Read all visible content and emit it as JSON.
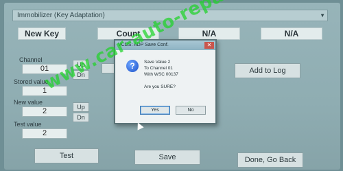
{
  "module_select": {
    "value": "Immobilizer (Key Adaptation)"
  },
  "headers": {
    "new_key": "New Key",
    "count": "Count",
    "na1": "N/A",
    "na2": "N/A"
  },
  "channel": {
    "label": "Channel",
    "value": "01",
    "up": "Up",
    "dn": "Dn"
  },
  "stored": {
    "label": "Stored value",
    "value": "1"
  },
  "new_value": {
    "label": "New value",
    "value": "2",
    "up": "Up",
    "dn": "Dn"
  },
  "test_value": {
    "label": "Test value",
    "value": "2"
  },
  "buttons": {
    "add_to_log": "Add to Log",
    "test": "Test",
    "save": "Save",
    "done": "Done, Go Back"
  },
  "dialog": {
    "title": "VCDS: ADP Save Conf.",
    "line1": "Save Value 2",
    "line2": "To Channel 01",
    "line3": "With WSC 00137",
    "question": "Are you SURE?",
    "yes": "Yes",
    "no": "No"
  },
  "watermark": "www.car-auto-repair.com"
}
